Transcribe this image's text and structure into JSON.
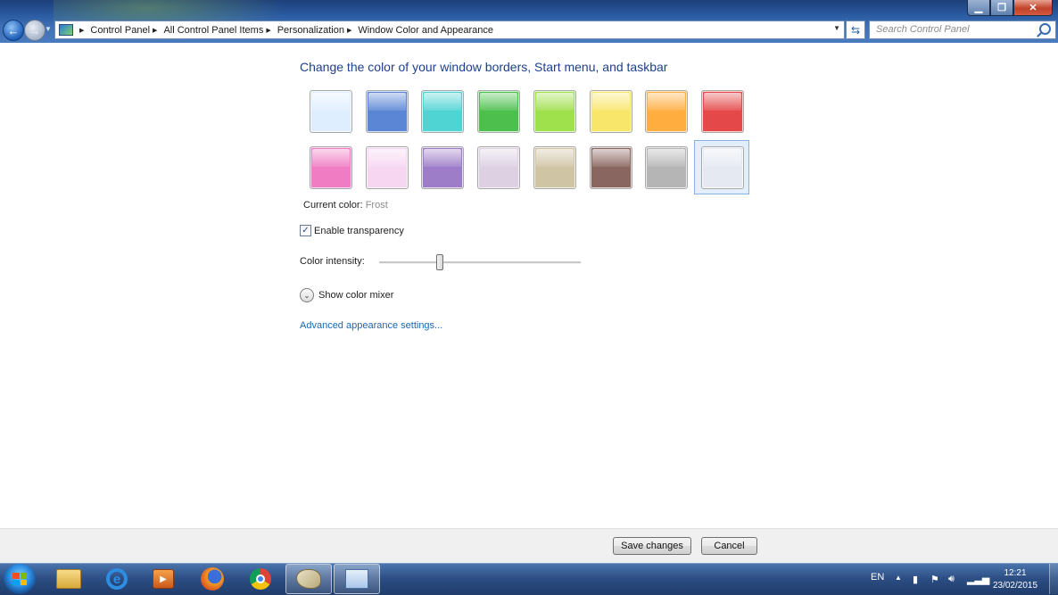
{
  "window": {
    "controls": {
      "minimize": "▁",
      "maximize": "❐",
      "close": "✕"
    }
  },
  "address_bar": {
    "crumbs": [
      "Control Panel",
      "All Control Panel Items",
      "Personalization",
      "Window Color and Appearance"
    ]
  },
  "search": {
    "placeholder": "Search Control Panel"
  },
  "main": {
    "heading": "Change the color of your window borders, Start menu, and taskbar",
    "swatches": [
      {
        "name": "sky",
        "color": "#dfeeff"
      },
      {
        "name": "twilight",
        "color": "#5b86d6"
      },
      {
        "name": "sea",
        "color": "#4fd3d3"
      },
      {
        "name": "leaf",
        "color": "#4cbf4c"
      },
      {
        "name": "lime",
        "color": "#9fe04d"
      },
      {
        "name": "lemon",
        "color": "#f8e66a"
      },
      {
        "name": "pumpkin",
        "color": "#ffad3f"
      },
      {
        "name": "ruby",
        "color": "#e44848"
      },
      {
        "name": "fuchsia",
        "color": "#f07cc4"
      },
      {
        "name": "blush",
        "color": "#f7d6f2"
      },
      {
        "name": "violet",
        "color": "#9d7cc8"
      },
      {
        "name": "lavender",
        "color": "#dcd0e2"
      },
      {
        "name": "taupe",
        "color": "#cfc4a4"
      },
      {
        "name": "chocolate",
        "color": "#8a6660"
      },
      {
        "name": "slate",
        "color": "#b5b5b5"
      },
      {
        "name": "frost",
        "color": "#e4e9f2"
      }
    ],
    "current_color_label": "Current color:",
    "current_color_value": "Frost",
    "enable_transparency_label": "Enable transparency",
    "enable_transparency_checked": true,
    "color_intensity_label": "Color intensity:",
    "color_intensity_fraction": 0.3,
    "show_color_mixer_label": "Show color mixer",
    "advanced_link": "Advanced appearance settings..."
  },
  "buttons": {
    "save": "Save changes",
    "cancel": "Cancel"
  },
  "taskbar": {
    "apps": [
      "folder-icon",
      "internet-explorer-icon",
      "media-player-icon",
      "firefox-icon",
      "chrome-icon",
      "paint-icon",
      "control-panel-icon"
    ],
    "language": "EN",
    "time": "12:21",
    "date": "23/02/2015"
  },
  "colors": {
    "heading": "#1e3f8f",
    "link": "#1b67b3",
    "taskbar": "#2d4f85"
  }
}
